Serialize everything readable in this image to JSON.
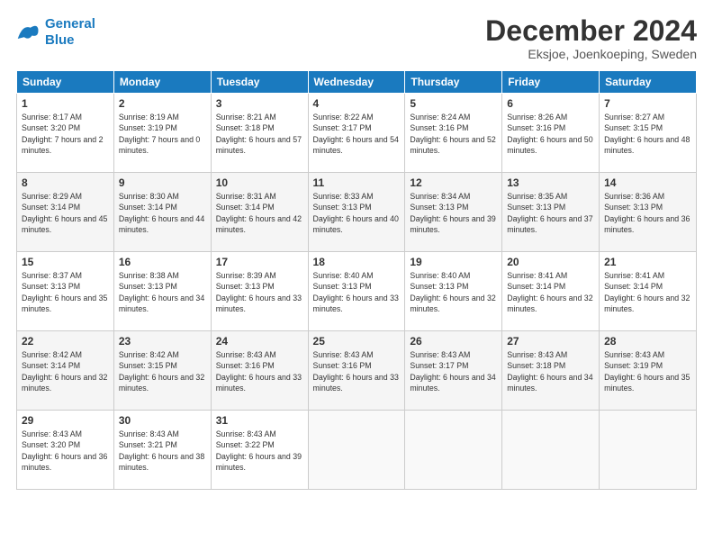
{
  "logo": {
    "line1": "General",
    "line2": "Blue"
  },
  "header": {
    "month": "December 2024",
    "location": "Eksjoe, Joenkoeping, Sweden"
  },
  "weekdays": [
    "Sunday",
    "Monday",
    "Tuesday",
    "Wednesday",
    "Thursday",
    "Friday",
    "Saturday"
  ],
  "weeks": [
    [
      {
        "day": "1",
        "sunrise": "Sunrise: 8:17 AM",
        "sunset": "Sunset: 3:20 PM",
        "daylight": "Daylight: 7 hours and 2 minutes."
      },
      {
        "day": "2",
        "sunrise": "Sunrise: 8:19 AM",
        "sunset": "Sunset: 3:19 PM",
        "daylight": "Daylight: 7 hours and 0 minutes."
      },
      {
        "day": "3",
        "sunrise": "Sunrise: 8:21 AM",
        "sunset": "Sunset: 3:18 PM",
        "daylight": "Daylight: 6 hours and 57 minutes."
      },
      {
        "day": "4",
        "sunrise": "Sunrise: 8:22 AM",
        "sunset": "Sunset: 3:17 PM",
        "daylight": "Daylight: 6 hours and 54 minutes."
      },
      {
        "day": "5",
        "sunrise": "Sunrise: 8:24 AM",
        "sunset": "Sunset: 3:16 PM",
        "daylight": "Daylight: 6 hours and 52 minutes."
      },
      {
        "day": "6",
        "sunrise": "Sunrise: 8:26 AM",
        "sunset": "Sunset: 3:16 PM",
        "daylight": "Daylight: 6 hours and 50 minutes."
      },
      {
        "day": "7",
        "sunrise": "Sunrise: 8:27 AM",
        "sunset": "Sunset: 3:15 PM",
        "daylight": "Daylight: 6 hours and 48 minutes."
      }
    ],
    [
      {
        "day": "8",
        "sunrise": "Sunrise: 8:29 AM",
        "sunset": "Sunset: 3:14 PM",
        "daylight": "Daylight: 6 hours and 45 minutes."
      },
      {
        "day": "9",
        "sunrise": "Sunrise: 8:30 AM",
        "sunset": "Sunset: 3:14 PM",
        "daylight": "Daylight: 6 hours and 44 minutes."
      },
      {
        "day": "10",
        "sunrise": "Sunrise: 8:31 AM",
        "sunset": "Sunset: 3:14 PM",
        "daylight": "Daylight: 6 hours and 42 minutes."
      },
      {
        "day": "11",
        "sunrise": "Sunrise: 8:33 AM",
        "sunset": "Sunset: 3:13 PM",
        "daylight": "Daylight: 6 hours and 40 minutes."
      },
      {
        "day": "12",
        "sunrise": "Sunrise: 8:34 AM",
        "sunset": "Sunset: 3:13 PM",
        "daylight": "Daylight: 6 hours and 39 minutes."
      },
      {
        "day": "13",
        "sunrise": "Sunrise: 8:35 AM",
        "sunset": "Sunset: 3:13 PM",
        "daylight": "Daylight: 6 hours and 37 minutes."
      },
      {
        "day": "14",
        "sunrise": "Sunrise: 8:36 AM",
        "sunset": "Sunset: 3:13 PM",
        "daylight": "Daylight: 6 hours and 36 minutes."
      }
    ],
    [
      {
        "day": "15",
        "sunrise": "Sunrise: 8:37 AM",
        "sunset": "Sunset: 3:13 PM",
        "daylight": "Daylight: 6 hours and 35 minutes."
      },
      {
        "day": "16",
        "sunrise": "Sunrise: 8:38 AM",
        "sunset": "Sunset: 3:13 PM",
        "daylight": "Daylight: 6 hours and 34 minutes."
      },
      {
        "day": "17",
        "sunrise": "Sunrise: 8:39 AM",
        "sunset": "Sunset: 3:13 PM",
        "daylight": "Daylight: 6 hours and 33 minutes."
      },
      {
        "day": "18",
        "sunrise": "Sunrise: 8:40 AM",
        "sunset": "Sunset: 3:13 PM",
        "daylight": "Daylight: 6 hours and 33 minutes."
      },
      {
        "day": "19",
        "sunrise": "Sunrise: 8:40 AM",
        "sunset": "Sunset: 3:13 PM",
        "daylight": "Daylight: 6 hours and 32 minutes."
      },
      {
        "day": "20",
        "sunrise": "Sunrise: 8:41 AM",
        "sunset": "Sunset: 3:14 PM",
        "daylight": "Daylight: 6 hours and 32 minutes."
      },
      {
        "day": "21",
        "sunrise": "Sunrise: 8:41 AM",
        "sunset": "Sunset: 3:14 PM",
        "daylight": "Daylight: 6 hours and 32 minutes."
      }
    ],
    [
      {
        "day": "22",
        "sunrise": "Sunrise: 8:42 AM",
        "sunset": "Sunset: 3:14 PM",
        "daylight": "Daylight: 6 hours and 32 minutes."
      },
      {
        "day": "23",
        "sunrise": "Sunrise: 8:42 AM",
        "sunset": "Sunset: 3:15 PM",
        "daylight": "Daylight: 6 hours and 32 minutes."
      },
      {
        "day": "24",
        "sunrise": "Sunrise: 8:43 AM",
        "sunset": "Sunset: 3:16 PM",
        "daylight": "Daylight: 6 hours and 33 minutes."
      },
      {
        "day": "25",
        "sunrise": "Sunrise: 8:43 AM",
        "sunset": "Sunset: 3:16 PM",
        "daylight": "Daylight: 6 hours and 33 minutes."
      },
      {
        "day": "26",
        "sunrise": "Sunrise: 8:43 AM",
        "sunset": "Sunset: 3:17 PM",
        "daylight": "Daylight: 6 hours and 34 minutes."
      },
      {
        "day": "27",
        "sunrise": "Sunrise: 8:43 AM",
        "sunset": "Sunset: 3:18 PM",
        "daylight": "Daylight: 6 hours and 34 minutes."
      },
      {
        "day": "28",
        "sunrise": "Sunrise: 8:43 AM",
        "sunset": "Sunset: 3:19 PM",
        "daylight": "Daylight: 6 hours and 35 minutes."
      }
    ],
    [
      {
        "day": "29",
        "sunrise": "Sunrise: 8:43 AM",
        "sunset": "Sunset: 3:20 PM",
        "daylight": "Daylight: 6 hours and 36 minutes."
      },
      {
        "day": "30",
        "sunrise": "Sunrise: 8:43 AM",
        "sunset": "Sunset: 3:21 PM",
        "daylight": "Daylight: 6 hours and 38 minutes."
      },
      {
        "day": "31",
        "sunrise": "Sunrise: 8:43 AM",
        "sunset": "Sunset: 3:22 PM",
        "daylight": "Daylight: 6 hours and 39 minutes."
      },
      null,
      null,
      null,
      null
    ]
  ]
}
